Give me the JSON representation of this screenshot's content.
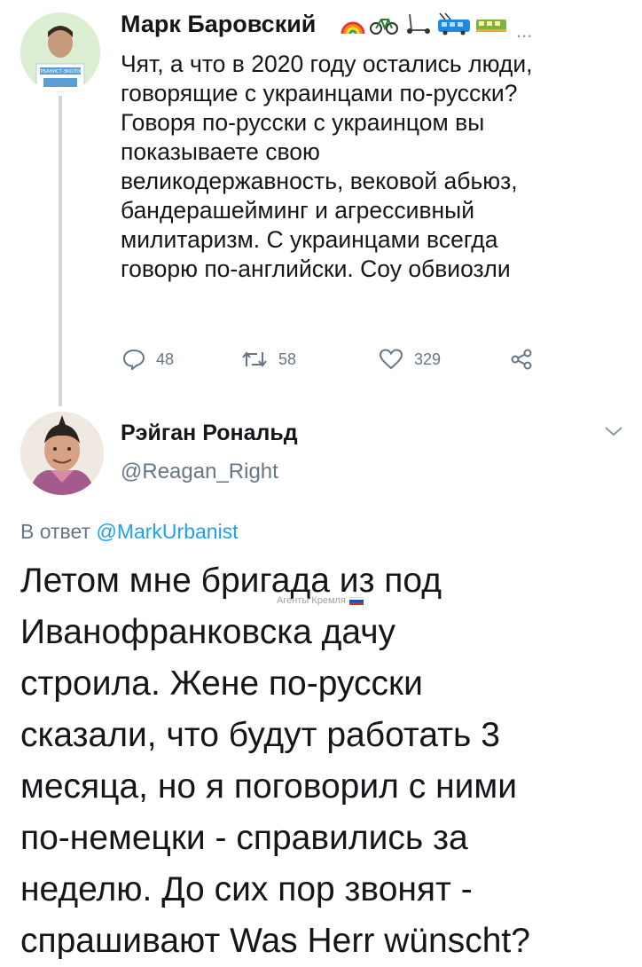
{
  "tweet1": {
    "author_name": "Марк Баровский",
    "name_emojis": [
      "rainbow-emoji",
      "bicycle-emoji",
      "scooter-emoji",
      "trolleybus-emoji",
      "tram-emoji"
    ],
    "more": "...",
    "avatar_caption": "УРБАНИСТ-ЭКОЛОГ",
    "text": "Чят, а что в 2020 году остались люди,\nговорящие с украинцами по-русски?\nГоворя по-русски с украинцом вы\nпоказываете свою\nвеликодержавность, вековой абьюз,\nбандерашейминг и агрессивный\nмилитаризм. С украинцами всегда\nговорю по-английски. Соу обвиозли",
    "replies": "48",
    "retweets": "58",
    "likes": "329"
  },
  "tweet2": {
    "author_name": "Рэйган Рональд",
    "handle": "@Reagan_Right",
    "reply_prefix": "В ответ ",
    "reply_mention": "@MarkUrbanist",
    "text": "Летом мне бригада из под\nИванофранковска дачу\nстроила. Жене по-русски\nсказали, что будут работать 3\nмесяца, но я поговорил с ними\nпо-немецки - справились за\nнеделю. До сих пор звонят -\nспрашивают Was Herr wünscht?"
  },
  "watermark": {
    "text": "Агенты Кремля"
  },
  "colors": {
    "text": "#14171a",
    "secondary": "#657786",
    "link": "#1da1f2",
    "thread_line": "#cfd6dc"
  }
}
